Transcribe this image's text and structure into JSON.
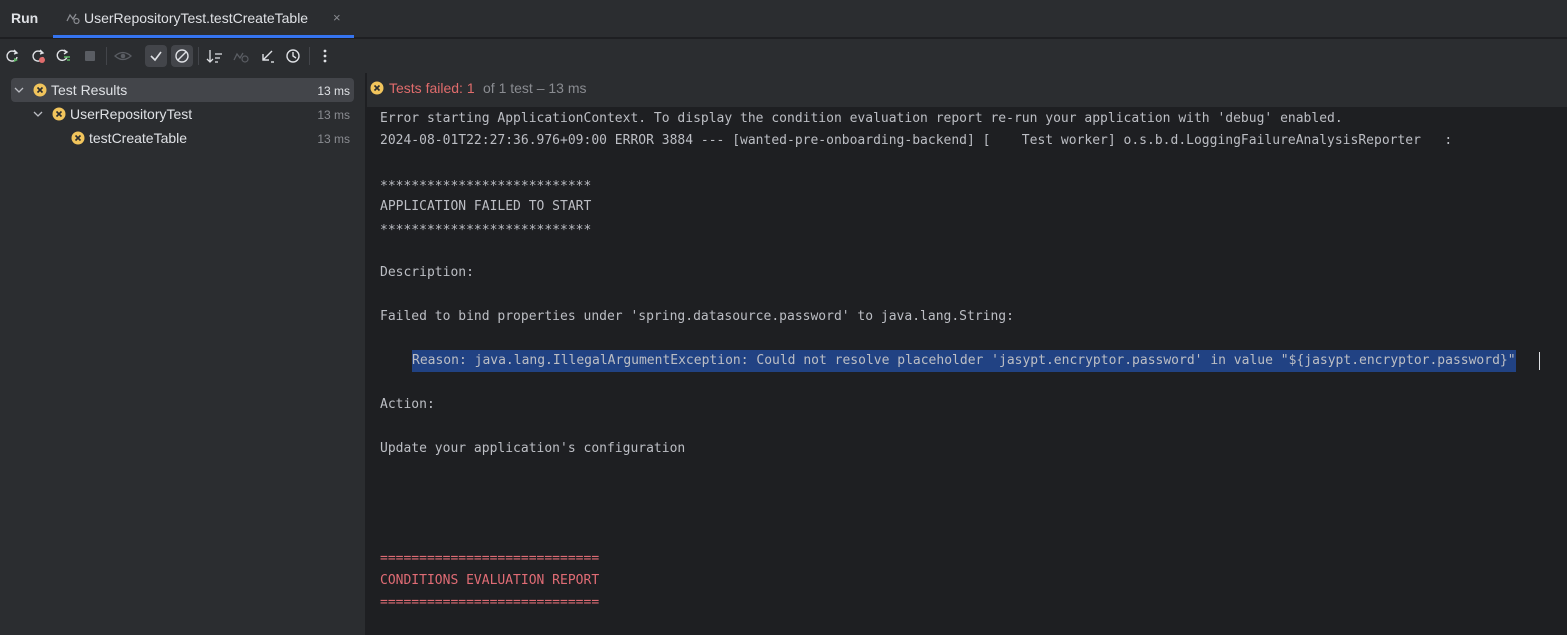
{
  "header": {
    "run_title": "Run",
    "tab_label": "UserRepositoryTest.testCreateTable",
    "tab_close": "×"
  },
  "toolbar": {
    "buttons": [
      "rerun-icon",
      "rerun-failed-icon",
      "toggle-auto-test-icon",
      "stop-icon",
      "show-ignored-icon",
      "show-passed-icon",
      "show-ignored-tests-icon",
      "sort-icon",
      "import-tests-icon",
      "export-icon",
      "history-icon",
      "more-icon"
    ]
  },
  "tree": {
    "items": [
      {
        "label": "Test Results",
        "time": "13 ms"
      },
      {
        "label": "UserRepositoryTest",
        "time": "13 ms"
      },
      {
        "label": "testCreateTable",
        "time": "13 ms"
      }
    ]
  },
  "console_header": {
    "failed_label": "Tests failed: ",
    "failed_count": "1",
    "summary": "of 1 test – 13 ms"
  },
  "console": {
    "lines": [
      "Error starting ApplicationContext. To display the condition evaluation report re-run your application with 'debug' enabled.",
      "2024-08-01T22:27:36.976+09:00 ERROR 3884 --- [wanted-pre-onboarding-backend] [    Test worker] o.s.b.d.LoggingFailureAnalysisReporter   :",
      "***************************",
      "APPLICATION FAILED TO START",
      "***************************",
      "Description:",
      "Failed to bind properties under 'spring.datasource.password' to java.lang.String:",
      "Reason: java.lang.IllegalArgumentException: Could not resolve placeholder 'jasypt.encryptor.password' in value \"${jasypt.encryptor.password}\"",
      "Action:",
      "Update your application's configuration",
      "============================",
      "CONDITIONS EVALUATION REPORT",
      "============================"
    ]
  },
  "colors": {
    "accent": "#3574f0",
    "error": "#e06c6c",
    "warning_icon": "#f2c55c",
    "selection": "#214283"
  }
}
